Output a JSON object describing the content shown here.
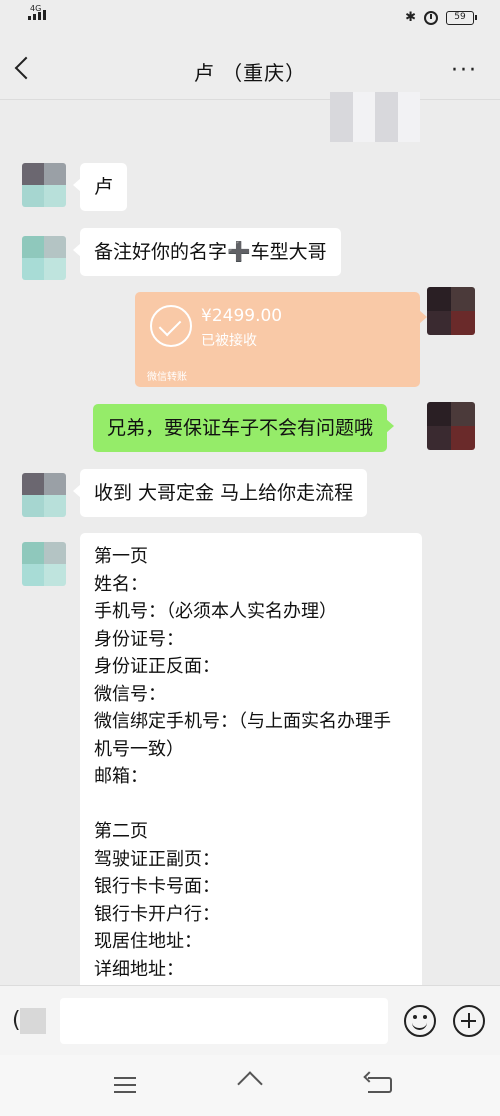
{
  "status_bar": {
    "network": "4G",
    "battery": "59",
    "bluetooth_icon": "bluetooth-icon",
    "alarm_icon": "alarm-icon"
  },
  "header": {
    "title": "卢   （重庆）",
    "back_icon": "back-icon",
    "more_icon": "more-icon",
    "more_glyph": "···"
  },
  "messages": [
    {
      "side": "left",
      "type": "text",
      "text": "卢"
    },
    {
      "side": "left",
      "type": "text",
      "text": "备注好你的名字➕车型大哥"
    },
    {
      "side": "right",
      "type": "transfer",
      "amount": "¥2499.00",
      "status": "已被接收",
      "label": "微信转账"
    },
    {
      "side": "right",
      "type": "text",
      "text": "兄弟，要保证车子不会有问题哦"
    },
    {
      "side": "left",
      "type": "text",
      "text": "收到 大哥定金 马上给你走流程"
    },
    {
      "side": "left",
      "type": "form",
      "lines": [
        "第一页",
        "姓名：",
        "手机号：（必须本人实名办理）",
        "身份证号：",
        "身份证正反面：",
        "微信号：",
        "微信绑定手机号：（与上面实名办理手机号一致）",
        "邮箱：",
        "",
        "第二页",
        "驾驶证正副页：",
        "银行卡卡号面：",
        "银行卡开户行：",
        "现居住地址：",
        "详细地址："
      ]
    }
  ],
  "input_bar": {
    "voice_icon": "voice-icon",
    "voice_glyph": "(",
    "placeholder": "",
    "emoji_icon": "emoji-icon",
    "plus_icon": "plus-icon"
  },
  "nav_bar": {
    "menu_icon": "menu-icon",
    "home_icon": "home-icon",
    "back_icon": "back-nav-icon"
  },
  "colors": {
    "background": "#ececec",
    "sent_bubble": "#95ec69",
    "received_bubble": "#ffffff",
    "transfer_card": "#f9c9a7"
  }
}
